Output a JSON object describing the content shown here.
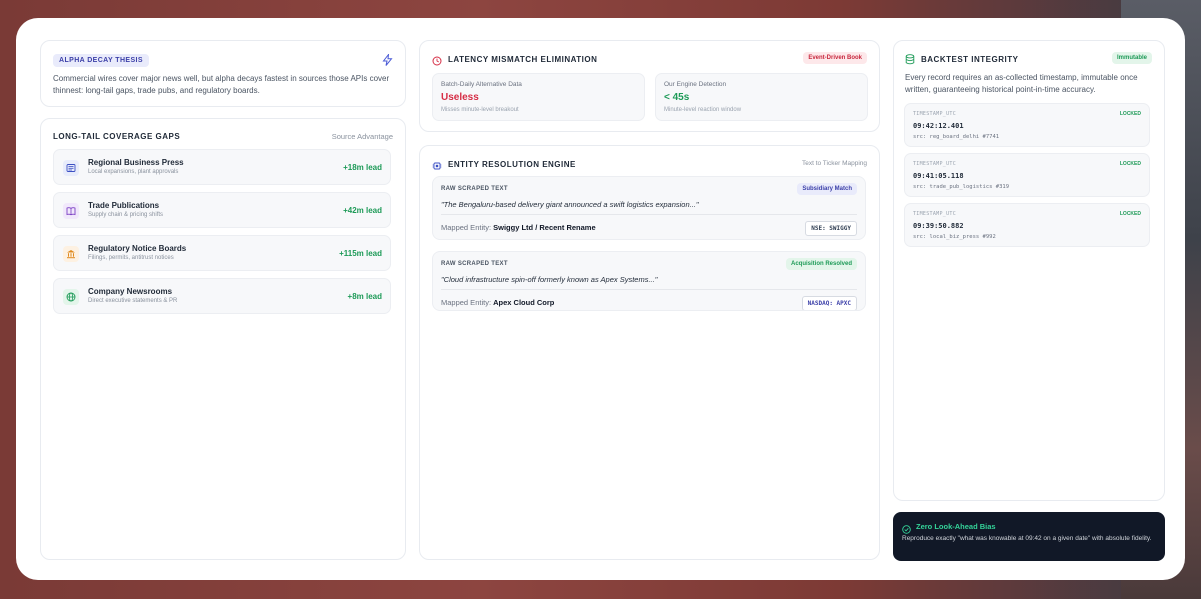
{
  "alpha": {
    "badge": "ALPHA DECAY THESIS",
    "body": "Commercial wires cover major news well, but alpha decays fastest in sources those APIs cover thinnest: long-tail gaps, trade pubs, and regulatory boards."
  },
  "coverage": {
    "title": "LONG-TAIL COVERAGE GAPS",
    "right_label": "Source Advantage",
    "items": [
      {
        "name": "Regional Business Press",
        "sub": "Local expansions, plant approvals",
        "lead": "+18m lead",
        "icon": "newspaper-icon"
      },
      {
        "name": "Trade Publications",
        "sub": "Supply chain & pricing shifts",
        "lead": "+42m lead",
        "icon": "book-icon"
      },
      {
        "name": "Regulatory Notice Boards",
        "sub": "Filings, permits, antitrust notices",
        "lead": "+115m lead",
        "icon": "bank-icon"
      },
      {
        "name": "Company Newsrooms",
        "sub": "Direct executive statements & PR",
        "lead": "+8m lead",
        "icon": "globe-icon"
      }
    ]
  },
  "latency": {
    "title": "LATENCY MISMATCH ELIMINATION",
    "badge": "Event-Driven Book",
    "left": {
      "label": "Batch-Daily Alternative Data",
      "value": "Useless",
      "sub": "Misses minute-level breakout"
    },
    "right": {
      "label": "Our Engine Detection",
      "value": "< 45s",
      "sub": "Minute-level reaction window"
    }
  },
  "entity": {
    "title": "ENTITY RESOLUTION ENGINE",
    "right_label": "Text to Ticker Mapping",
    "items": [
      {
        "raw_label": "RAW SCRAPED TEXT",
        "badge": "Subsidiary Match",
        "quote": "\"The Bengaluru-based delivery giant announced a swift logistics expansion...\"",
        "mapped_label": "Mapped Entity:",
        "mapped": "Swiggy Ltd / Recent Rename",
        "ticker": "NSE: SWIGGY"
      },
      {
        "raw_label": "RAW SCRAPED TEXT",
        "badge": "Acquisition Resolved",
        "quote": "\"Cloud infrastructure spin-off formerly known as Apex Systems...\"",
        "mapped_label": "Mapped Entity:",
        "mapped": "Apex Cloud Corp",
        "ticker": "NASDAQ: APXC"
      }
    ]
  },
  "backtest": {
    "title": "BACKTEST INTEGRITY",
    "badge": "Immutable",
    "body": "Every record requires an as-collected timestamp, immutable once written, guaranteeing historical point-in-time accuracy.",
    "records": [
      {
        "label": "TIMESTAMP_UTC",
        "locked": "LOCKED",
        "time": "09:42:12.401",
        "src": "src: reg_board_delhi #7741"
      },
      {
        "label": "TIMESTAMP_UTC",
        "locked": "LOCKED",
        "time": "09:41:05.118",
        "src": "src: trade_pub_logistics #319"
      },
      {
        "label": "TIMESTAMP_UTC",
        "locked": "LOCKED",
        "time": "09:39:50.882",
        "src": "src: local_biz_press #992"
      }
    ]
  },
  "lookahead": {
    "title": "Zero Look-Ahead Bias",
    "body": "Reproduce exactly \"what was knowable at 09:42 on a given date\" with absolute fidelity."
  },
  "colors": {
    "accent_green": "#1d9a57",
    "accent_red": "#d62d45",
    "accent_indigo": "#3b3fa8",
    "dark_panel": "#111827"
  }
}
